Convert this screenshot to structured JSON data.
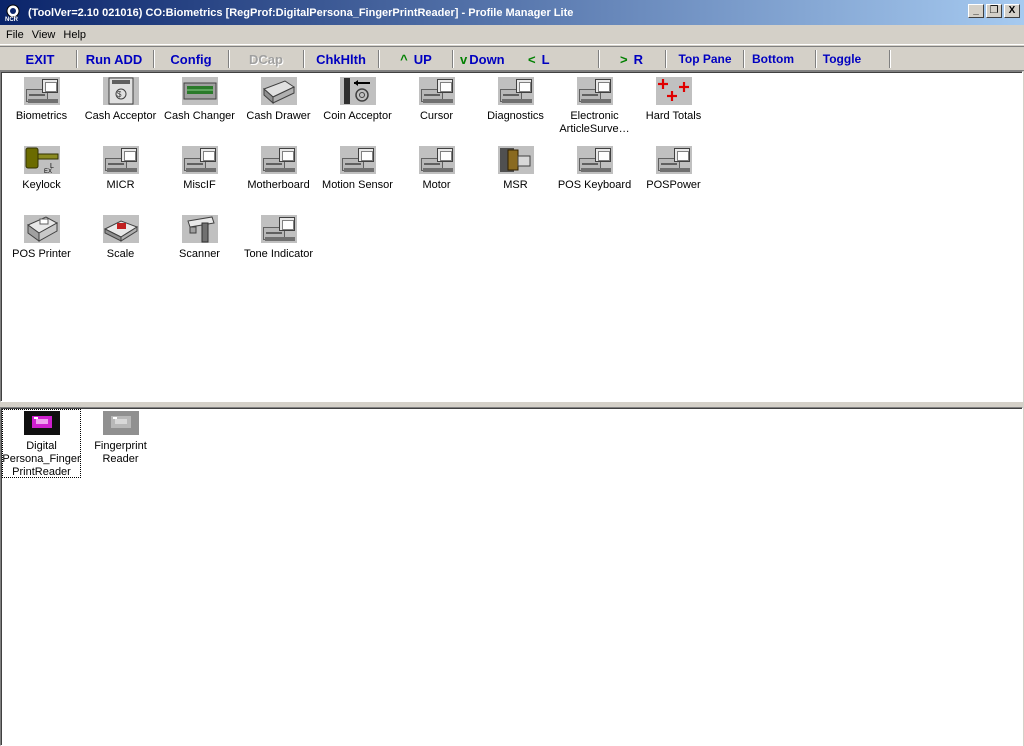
{
  "window": {
    "title": "(ToolVer=2.10 021016) CO:Biometrics [RegProf:DigitalPersona_FingerPrintReader] - Profile Manager Lite",
    "buttons": [
      "_",
      "❐",
      "X"
    ]
  },
  "menu": [
    "File",
    "View",
    "Help"
  ],
  "toolbar": {
    "exit": "EXIT",
    "run_add": "Run ADD",
    "config": "Config",
    "dcap": "DCap",
    "chkhlth": "ChkHlth",
    "up": "UP",
    "down": "Down",
    "left": "L",
    "right": "R",
    "top_pane": "Top Pane",
    "bottom": "Bottom",
    "toggle": "Toggle",
    "arrow_up": "^",
    "arrow_down": "v",
    "arrow_left": "<",
    "arrow_right": ">"
  },
  "top_pane": {
    "items": [
      {
        "label": "Biometrics",
        "icon": "computer-icon"
      },
      {
        "label": "Cash Acceptor",
        "icon": "cash-acceptor-icon"
      },
      {
        "label": "Cash Changer",
        "icon": "cash-changer-icon"
      },
      {
        "label": "Cash Drawer",
        "icon": "cash-drawer-icon"
      },
      {
        "label": "Coin Acceptor",
        "icon": "coin-acceptor-icon"
      },
      {
        "label": "Cursor",
        "icon": "computer-icon"
      },
      {
        "label": "Diagnostics",
        "icon": "computer-icon"
      },
      {
        "label": "Electronic ArticleSurve…",
        "icon": "computer-icon"
      },
      {
        "label": "Hard Totals",
        "icon": "hard-totals-icon"
      },
      {
        "label": "Keylock",
        "icon": "key-icon"
      },
      {
        "label": "MICR",
        "icon": "computer-icon"
      },
      {
        "label": "MiscIF",
        "icon": "computer-icon"
      },
      {
        "label": "Motherboard",
        "icon": "computer-icon"
      },
      {
        "label": "Motion Sensor",
        "icon": "computer-icon"
      },
      {
        "label": "Motor",
        "icon": "computer-icon"
      },
      {
        "label": "MSR",
        "icon": "card-swipe-icon"
      },
      {
        "label": "POS Keyboard",
        "icon": "computer-icon"
      },
      {
        "label": "POSPower",
        "icon": "computer-icon"
      },
      {
        "label": "POS Printer",
        "icon": "printer-icon"
      },
      {
        "label": "Scale",
        "icon": "scale-icon"
      },
      {
        "label": "Scanner",
        "icon": "scanner-icon"
      },
      {
        "label": "Tone Indicator",
        "icon": "computer-icon"
      }
    ]
  },
  "bottom_pane": {
    "items": [
      {
        "label": "Digital Persona_Finger PrintReader",
        "icon": "fingerprint-reader-icon",
        "selected": true
      },
      {
        "label": "Fingerprint Reader",
        "icon": "fingerprint-reader-icon",
        "selected": false
      }
    ]
  },
  "colors": {
    "title_gradient_start": "#0a246a",
    "title_gradient_end": "#a6caf0",
    "toolbar_text": "#0000c0",
    "arrow_green": "#008000",
    "disabled": "#a0a0a0"
  }
}
